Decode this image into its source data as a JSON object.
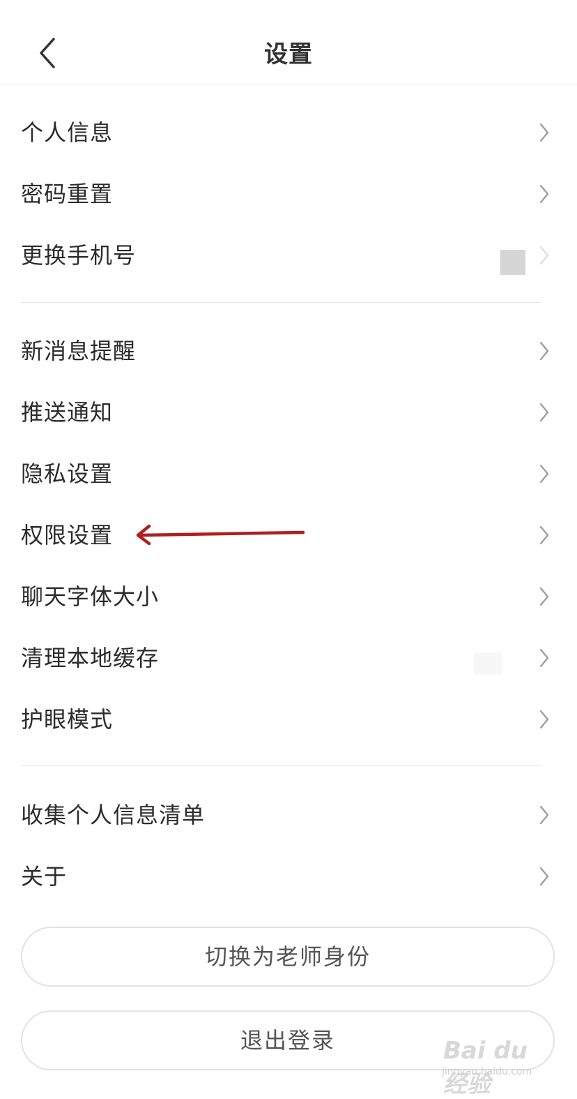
{
  "header": {
    "back_icon": "chevron-left-icon",
    "title": "设置"
  },
  "groups": [
    {
      "items": [
        {
          "label": "个人信息"
        },
        {
          "label": "密码重置"
        },
        {
          "label": "更换手机号"
        }
      ]
    },
    {
      "items": [
        {
          "label": "新消息提醒"
        },
        {
          "label": "推送通知"
        },
        {
          "label": "隐私设置"
        },
        {
          "label": "权限设置"
        },
        {
          "label": "聊天字体大小"
        },
        {
          "label": "清理本地缓存"
        },
        {
          "label": "护眼模式"
        }
      ]
    },
    {
      "items": [
        {
          "label": "收集个人信息清单"
        },
        {
          "label": "关于"
        }
      ]
    }
  ],
  "buttons": {
    "switch_role": "切换为老师身份",
    "logout": "退出登录"
  },
  "annotation": {
    "arrow_color": "#b01e1e",
    "points_to": "权限设置"
  },
  "watermark": {
    "brand": "Bai du 经验",
    "url": "jingyan.baidu.com"
  },
  "colors": {
    "text": "#2b2b2b",
    "divider": "#e4e4e4",
    "chevron": "#9a9a9a"
  }
}
